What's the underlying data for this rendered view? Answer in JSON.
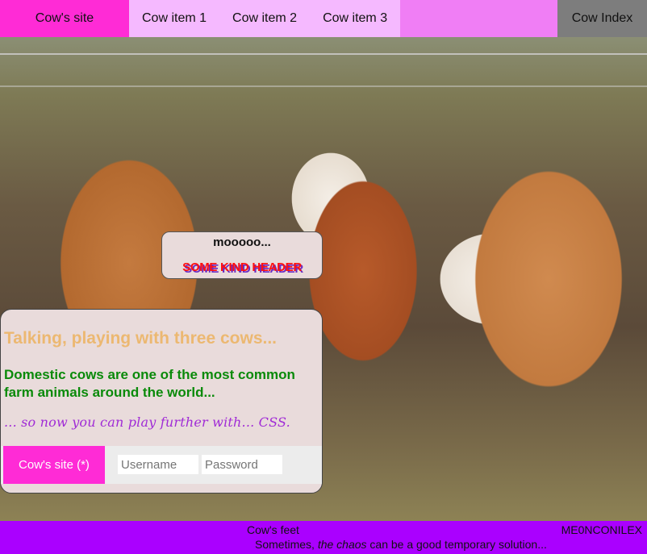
{
  "nav": {
    "home": "Cow's site",
    "items": [
      "Cow item 1",
      "Cow item 2",
      "Cow item 3"
    ],
    "index": "Cow Index"
  },
  "moo": {
    "text": "mooooo...",
    "header": "SOME KIND HEADER"
  },
  "panel": {
    "title": "Talking, playing with three cows...",
    "description": "Domestic cows are one of the most common farm animals around the world...",
    "note": "... so now you can play further with... CSS.",
    "button": "Cow's site (*)",
    "username_placeholder": "Username",
    "password_placeholder": "Password"
  },
  "footer": {
    "left": "Cow's feet",
    "right": "ME0NCONILEX",
    "quote_before": "Sometimes, ",
    "quote_em": "the chaos",
    "quote_after": " can be a good temporary solution..."
  }
}
